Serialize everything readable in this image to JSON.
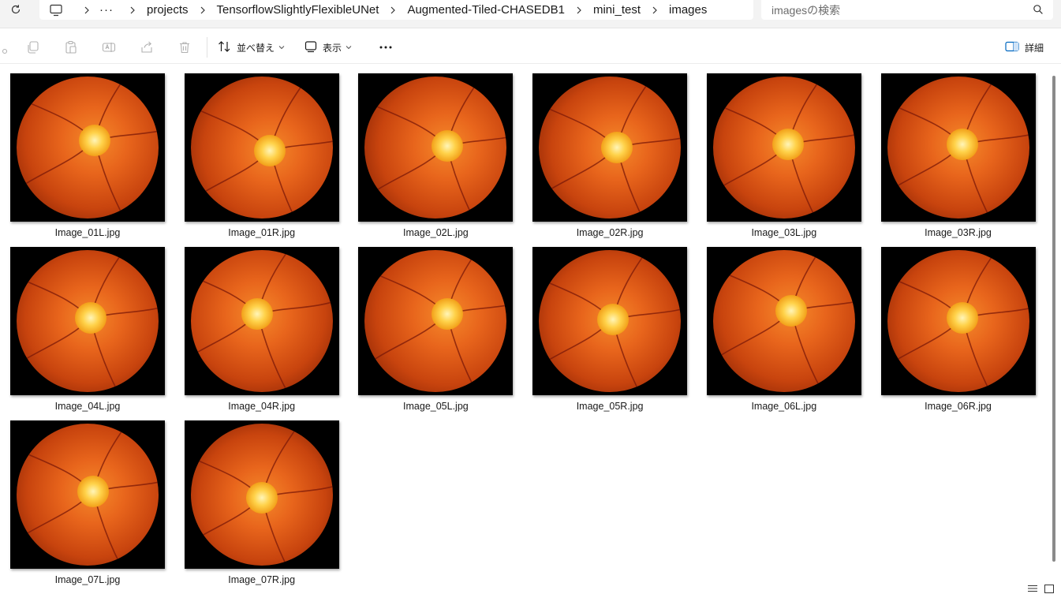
{
  "breadcrumb": {
    "overflow": "···",
    "items": [
      "projects",
      "TensorflowSlightlyFlexibleUNet",
      "Augmented-Tiled-CHASEDB1",
      "mini_test",
      "images"
    ]
  },
  "search": {
    "placeholder": "imagesの検索"
  },
  "toolbar": {
    "sort_label": "並べ替え",
    "view_label": "表示",
    "details_label": "詳細"
  },
  "files": [
    {
      "name": "Image_01L.jpg"
    },
    {
      "name": "Image_01R.jpg"
    },
    {
      "name": "Image_02L.jpg"
    },
    {
      "name": "Image_02R.jpg"
    },
    {
      "name": "Image_03L.jpg"
    },
    {
      "name": "Image_03R.jpg"
    },
    {
      "name": "Image_04L.jpg"
    },
    {
      "name": "Image_04R.jpg"
    },
    {
      "name": "Image_05L.jpg"
    },
    {
      "name": "Image_05R.jpg"
    },
    {
      "name": "Image_06L.jpg"
    },
    {
      "name": "Image_06R.jpg"
    },
    {
      "name": "Image_07L.jpg"
    },
    {
      "name": "Image_07R.jpg"
    }
  ],
  "colors": {
    "fundus_center": "#e8651c",
    "fundus_edge": "#6a1d04",
    "vessel": "#7a1808",
    "accent": "#0067c0"
  },
  "icons": {
    "refresh": "refresh-icon",
    "pc": "this-pc-icon",
    "separator": "chevron-right-icon",
    "search": "search-icon",
    "cut": "cut-icon",
    "copy": "copy-icon",
    "paste": "paste-icon",
    "rename": "rename-icon",
    "share": "share-icon",
    "delete": "delete-icon",
    "sort": "sort-icon",
    "view": "view-icon",
    "more": "more-icon",
    "details": "details-pane-icon"
  }
}
